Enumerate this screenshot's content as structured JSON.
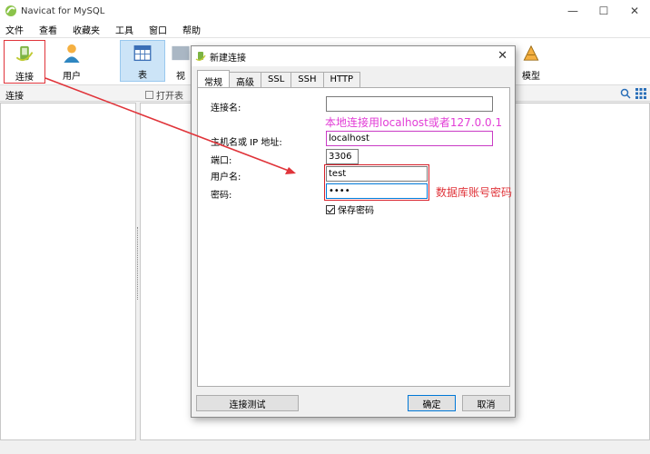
{
  "window": {
    "title": "Navicat for MySQL",
    "controls": [
      "—",
      "☐",
      "✕"
    ]
  },
  "menu": [
    "文件",
    "查看",
    "收藏夹",
    "工具",
    "窗口",
    "帮助"
  ],
  "toolbar": {
    "connect_label": "连接",
    "user_label": "用户",
    "table_label": "表",
    "view_label": "视",
    "model_label": "模型"
  },
  "subbar": {
    "connection_label": "连接",
    "open_table_label": "打开表"
  },
  "dialog": {
    "title": "新建连接",
    "tabs": [
      "常规",
      "高级",
      "SSL",
      "SSH",
      "HTTP"
    ],
    "fields": {
      "connection_name_label": "连接名:",
      "connection_name_value": "",
      "host_label": "主机名或 IP 地址:",
      "host_value": "localhost",
      "port_label": "端口:",
      "port_value": "3306",
      "username_label": "用户名:",
      "username_value": "test",
      "password_label": "密码:",
      "password_value": "••••"
    },
    "save_password_label": "保存密码",
    "test_button": "连接测试",
    "ok_button": "确定",
    "cancel_button": "取消"
  },
  "annotations": {
    "local_note": "本地连接用localhost或者127.0.0.1",
    "account_note": "数据库账号密码"
  },
  "colors": {
    "annotation_pink": "#e23cd6",
    "annotation_red": "#e0343a",
    "selected_tool": "#cce4f7"
  }
}
